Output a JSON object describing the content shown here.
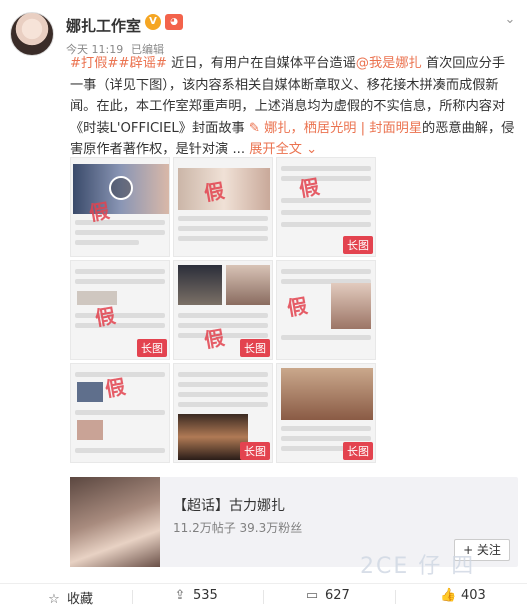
{
  "header": {
    "user_name": "娜扎工作室",
    "verified": "V",
    "vip": "◕",
    "time": "今天 11:19",
    "edited": "已编辑",
    "menu_icon": "chevron-down-icon"
  },
  "post": {
    "tag1": "#打假#",
    "tag2": "#辟谣#",
    "text1": " 近日，有用户在自媒体平台造谣",
    "mention": "@我是娜扎",
    "text2": " 首次回应分手一事（详见下图），该内容系相关自媒体断章取义、移花接木拼凑而成假新闻。在此，本工作室郑重声明，上述消息均为虚假的不实信息，所称内容对《时装L'OFFICIEL》封面故事 ",
    "link_text": "娜扎，栖居光明 | 封面明星",
    "text3": "的恶意曲解，侵害原作者著作权，是针对演 ... ",
    "expand": "展开全文"
  },
  "images": {
    "long_label": "长图",
    "fake_label": "假"
  },
  "topic_card": {
    "title": "【超话】古力娜扎",
    "stats": "11.2万帖子 39.3万粉丝",
    "follow": "+ 关注"
  },
  "footer": {
    "collect": "收藏",
    "share_count": "535",
    "comment_count": "627",
    "like_count": "403"
  },
  "watermark": "2CE 仔 四"
}
